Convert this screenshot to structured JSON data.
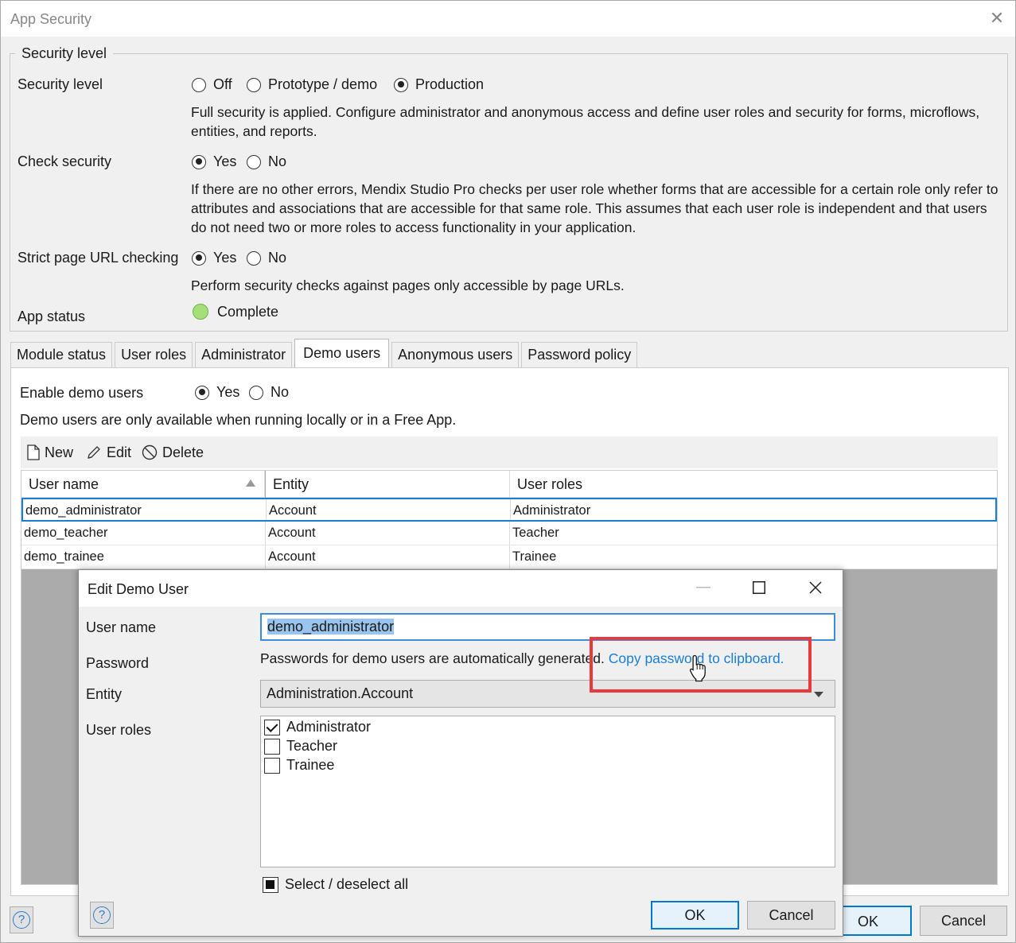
{
  "window": {
    "title": "App Security",
    "close_glyph": "✕"
  },
  "security_group": {
    "legend": "Security level",
    "security_level": {
      "label": "Security level",
      "options": [
        "Off",
        "Prototype / demo",
        "Production"
      ],
      "selected": "Production",
      "description": "Full security is applied. Configure administrator and anonymous access and define user roles and security for forms, microflows, entities, and reports."
    },
    "check_security": {
      "label": "Check security",
      "options": [
        "Yes",
        "No"
      ],
      "selected": "Yes",
      "description": "If there are no other errors, Mendix Studio Pro checks per user role whether forms that are accessible for a certain role only refer to attributes and associations that are accessible for that same role. This assumes that each user role is independent and that users do not need two or more roles to access functionality in your application."
    },
    "strict_page_url": {
      "label": "Strict page URL checking",
      "options": [
        "Yes",
        "No"
      ],
      "selected": "Yes",
      "description": "Perform security checks against pages only accessible by page URLs."
    },
    "app_status": {
      "label": "App status",
      "value": "Complete",
      "color": "#a6df7a"
    }
  },
  "tabs": [
    "Module status",
    "User roles",
    "Administrator",
    "Demo users",
    "Anonymous users",
    "Password policy"
  ],
  "active_tab": "Demo users",
  "demo_users": {
    "enable_label": "Enable demo users",
    "enable_options": [
      "Yes",
      "No"
    ],
    "enable_selected": "Yes",
    "note": "Demo users are only available when running locally or in a Free App.",
    "toolbar": {
      "new": "New",
      "edit": "Edit",
      "delete": "Delete"
    },
    "columns": [
      "User name",
      "Entity",
      "User roles"
    ],
    "rows": [
      [
        "demo_administrator",
        "Account",
        "Administrator"
      ],
      [
        "demo_teacher",
        "Account",
        "Teacher"
      ],
      [
        "demo_trainee",
        "Account",
        "Trainee"
      ]
    ]
  },
  "main_buttons": {
    "ok": "OK",
    "cancel": "Cancel",
    "help": "?"
  },
  "dialog": {
    "title": "Edit Demo User",
    "user_name_label": "User name",
    "user_name_value": "demo_administrator",
    "password_label": "Password",
    "password_text": "Passwords for demo users are automatically generated.",
    "password_link": "Copy password to clipboard.",
    "entity_label": "Entity",
    "entity_value": "Administration.Account",
    "user_roles_label": "User roles",
    "roles": [
      {
        "name": "Administrator",
        "checked": true
      },
      {
        "name": "Teacher",
        "checked": false
      },
      {
        "name": "Trainee",
        "checked": false
      }
    ],
    "select_all": "Select / deselect all",
    "ok": "OK",
    "cancel": "Cancel",
    "help": "?"
  },
  "colors": {
    "accent": "#1a7fd4",
    "highlight_box": "#e8393d"
  }
}
